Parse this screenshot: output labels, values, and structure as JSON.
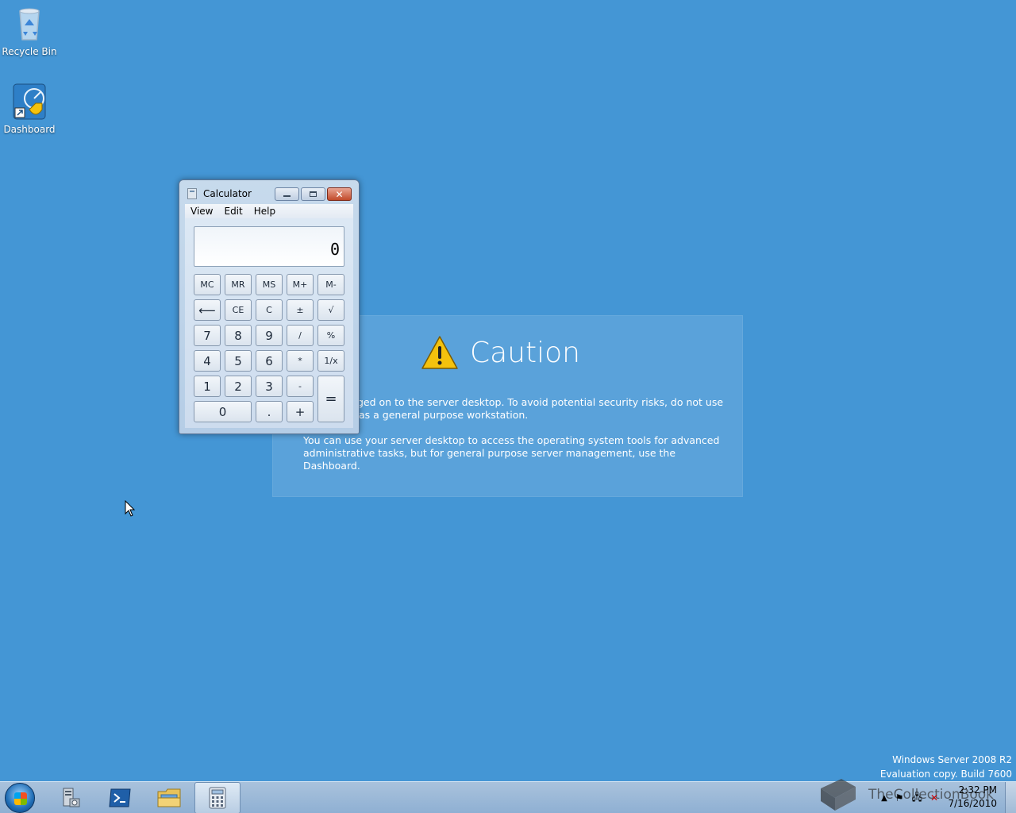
{
  "desktop": {
    "icons": [
      {
        "label": "Recycle Bin",
        "icon": "recycle-bin-icon"
      },
      {
        "label": "Dashboard",
        "icon": "dashboard-icon"
      }
    ],
    "background_color": "#4496d5"
  },
  "caution": {
    "title": "Caution",
    "paragraph1_line1": "ged on to the server desktop. To avoid potential security risks, do not use",
    "paragraph1_line2": "as a general purpose workstation.",
    "paragraph2_line1": "You can use your server desktop to access the operating system tools for advanced",
    "paragraph2_line2": "administrative tasks, but for general purpose server management, use the Dashboard."
  },
  "calculator": {
    "title": "Calculator",
    "menu": [
      "View",
      "Edit",
      "Help"
    ],
    "display": "0",
    "keys": {
      "mc": "MC",
      "mr": "MR",
      "ms": "MS",
      "mplus": "M+",
      "mminus": "M-",
      "back": "⟵",
      "ce": "CE",
      "c": "C",
      "plusminus": "±",
      "sqrt": "√",
      "k7": "7",
      "k8": "8",
      "k9": "9",
      "div": "/",
      "pct": "%",
      "k4": "4",
      "k5": "5",
      "k6": "6",
      "mul": "*",
      "recip": "1/x",
      "k1": "1",
      "k2": "2",
      "k3": "3",
      "sub": "-",
      "eq": "=",
      "k0": "0",
      "dot": ".",
      "add": "+"
    }
  },
  "watermark": {
    "line1": "Windows Server 2008 R2",
    "line2": "Evaluation copy. Build 7600"
  },
  "taskbar": {
    "buttons": [
      "start-button",
      "server-manager-icon",
      "powershell-icon",
      "explorer-icon",
      "calculator-icon"
    ],
    "tray_overlay_text": "TheCollectionBook",
    "clock_time": "2:32 PM",
    "clock_date": "7/16/2010"
  }
}
